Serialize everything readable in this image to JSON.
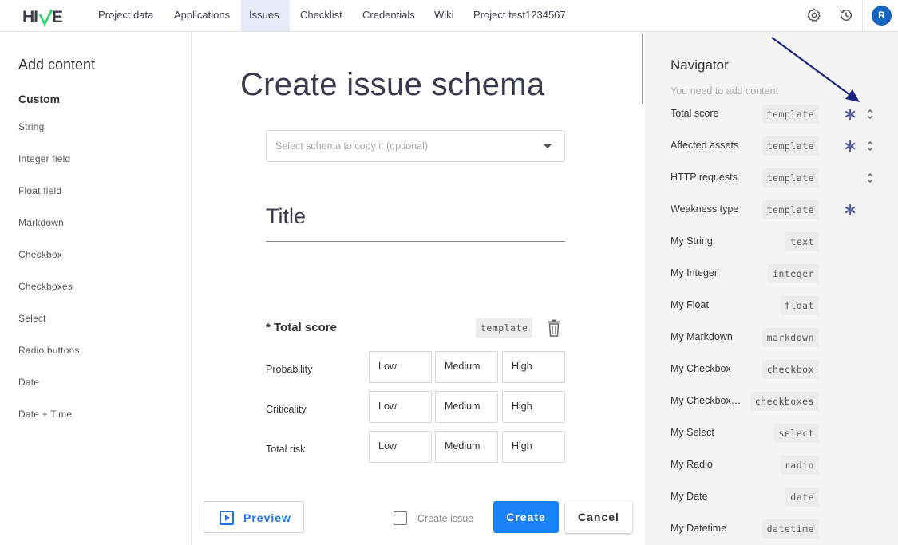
{
  "app": {
    "logo_text": "HIVE",
    "avatar_initial": "R"
  },
  "nav": {
    "items": [
      "Project data",
      "Applications",
      "Issues",
      "Checklist",
      "Credentials",
      "Wiki",
      "Project test1234567"
    ],
    "active": "Issues"
  },
  "left_panel": {
    "title": "Add content",
    "section": "Custom",
    "items": [
      "String",
      "Integer field",
      "Float field",
      "Markdown",
      "Checkbox",
      "Checkboxes",
      "Select",
      "Radio buttons",
      "Date",
      "Date + Time"
    ]
  },
  "main": {
    "title": "Create issue schema",
    "schema_select_placeholder": "Select schema to copy it (optional)",
    "title_field": "Title",
    "field": {
      "label": "* Total score",
      "tag": "template",
      "rows": [
        {
          "label": "Probability",
          "options": [
            "Low",
            "Medium",
            "High"
          ]
        },
        {
          "label": "Criticality",
          "options": [
            "Low",
            "Medium",
            "High"
          ]
        },
        {
          "label": "Total risk",
          "options": [
            "Low",
            "Medium",
            "High"
          ]
        }
      ]
    },
    "preview_label": "Preview",
    "create_issue_label": "Create issue",
    "create_label": "Create",
    "cancel_label": "Cancel"
  },
  "navigator": {
    "title": "Navigator",
    "hint": "You need to add content",
    "items": [
      {
        "name": "Total score",
        "tag": "template",
        "required": true,
        "collapsible": true
      },
      {
        "name": "Affected assets",
        "tag": "template",
        "required": true,
        "collapsible": true
      },
      {
        "name": "HTTP requests",
        "tag": "template",
        "required": false,
        "collapsible": true
      },
      {
        "name": "Weakness type",
        "tag": "template",
        "required": true,
        "collapsible": false
      },
      {
        "name": "My String",
        "tag": "text",
        "required": false,
        "collapsible": false
      },
      {
        "name": "My Integer",
        "tag": "integer",
        "required": false,
        "collapsible": false
      },
      {
        "name": "My Float",
        "tag": "float",
        "required": false,
        "collapsible": false
      },
      {
        "name": "My Markdown",
        "tag": "markdown",
        "required": false,
        "collapsible": false
      },
      {
        "name": "My Checkbox",
        "tag": "checkbox",
        "required": false,
        "collapsible": false
      },
      {
        "name": "My Checkbox…",
        "tag": "checkboxes",
        "required": false,
        "collapsible": false
      },
      {
        "name": "My Select",
        "tag": "select",
        "required": false,
        "collapsible": false
      },
      {
        "name": "My Radio",
        "tag": "radio",
        "required": false,
        "collapsible": false
      },
      {
        "name": "My Date",
        "tag": "date",
        "required": false,
        "collapsible": false
      },
      {
        "name": "My Datetime",
        "tag": "datetime",
        "required": false,
        "collapsible": false
      }
    ]
  },
  "colors": {
    "accent": "#1a82f7",
    "nav_active_bg": "#e8ebf7",
    "star": "#5a5f9e",
    "annotation_arrow": "#1a237e",
    "logo_green": "#3bd16f"
  }
}
